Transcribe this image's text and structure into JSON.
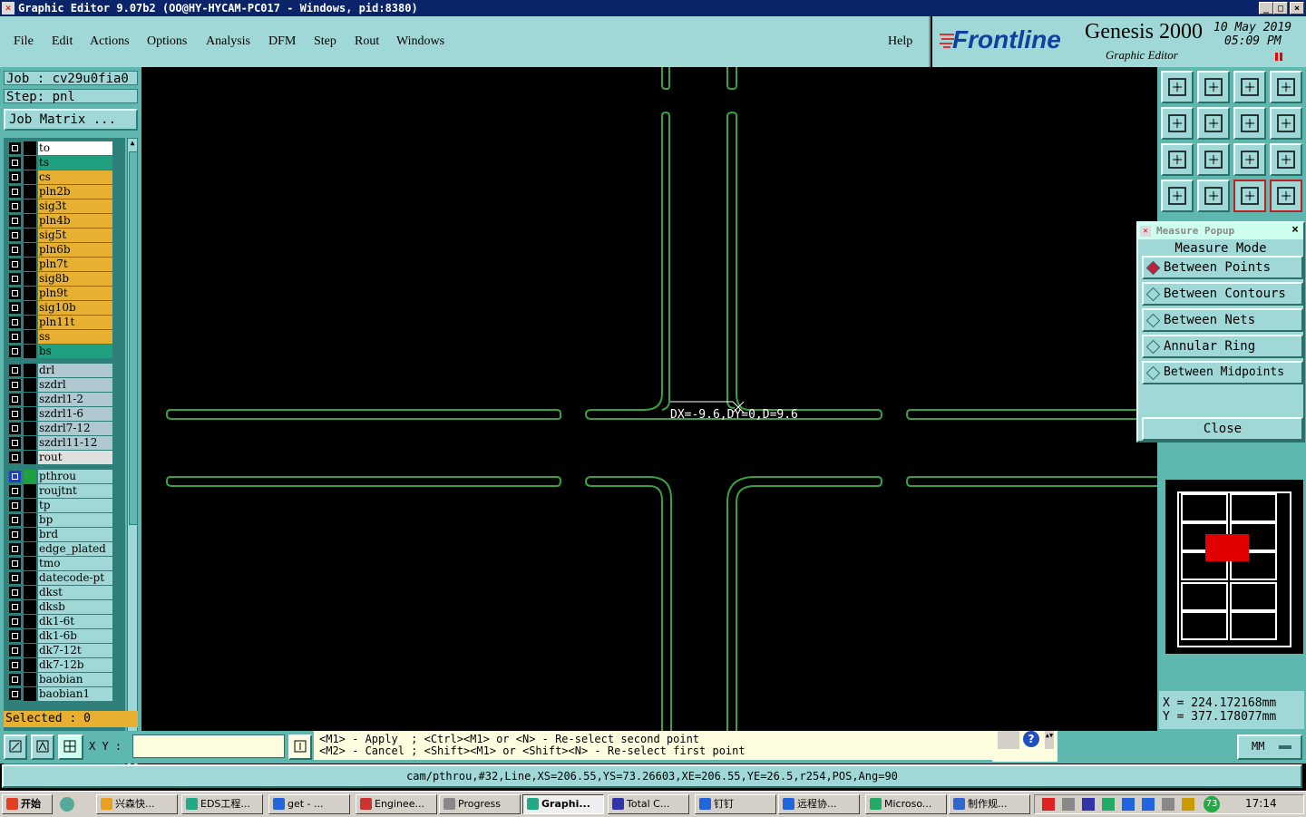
{
  "window": {
    "title": "Graphic Editor 9.07b2 (OO@HY-HYCAM-PC017 - Windows, pid:8380)",
    "controls": [
      "_",
      "□",
      "×"
    ]
  },
  "menu": [
    "File",
    "Edit",
    "Actions",
    "Options",
    "Analysis",
    "DFM",
    "Step",
    "Rout",
    "Windows"
  ],
  "help_label": "Help",
  "brand": {
    "logo": "Frontline",
    "product": "Genesis 2000",
    "subtitle": "Graphic Editor",
    "date": "10 May 2019",
    "time": "05:09 PM"
  },
  "job": {
    "job_line": "Job : cv29u0fia0",
    "step_line": "Step: pnl",
    "matrix_button": "Job Matrix ..."
  },
  "layers": {
    "board": [
      {
        "name": "to",
        "color": "#ffffff"
      },
      {
        "name": "ts",
        "color": "#20a080"
      },
      {
        "name": "cs",
        "color": "#e8b030"
      },
      {
        "name": "pln2b",
        "color": "#e8b030"
      },
      {
        "name": "sig3t",
        "color": "#e8b030"
      },
      {
        "name": "pln4b",
        "color": "#e8b030"
      },
      {
        "name": "sig5t",
        "color": "#e8b030"
      },
      {
        "name": "pln6b",
        "color": "#e8b030"
      },
      {
        "name": "pln7t",
        "color": "#e8b030"
      },
      {
        "name": "sig8b",
        "color": "#e8b030"
      },
      {
        "name": "pln9t",
        "color": "#e8b030"
      },
      {
        "name": "sig10b",
        "color": "#e8b030"
      },
      {
        "name": "pln11t",
        "color": "#e8b030"
      },
      {
        "name": "ss",
        "color": "#e8b030"
      },
      {
        "name": "bs",
        "color": "#20a080"
      }
    ],
    "drill": [
      {
        "name": "drl",
        "color": "#b0c8d0"
      },
      {
        "name": "szdrl",
        "color": "#b0c8d0"
      },
      {
        "name": "szdrl1-2",
        "color": "#b0c8d0"
      },
      {
        "name": "szdrl1-6",
        "color": "#b0c8d0"
      },
      {
        "name": "szdrl7-12",
        "color": "#b0c8d0"
      },
      {
        "name": "szdrl11-12",
        "color": "#b0c8d0"
      },
      {
        "name": "rout",
        "color": "#e0e0e0"
      }
    ],
    "misc": [
      {
        "name": "pthrou",
        "color": "#9fd8d6"
      },
      {
        "name": "roujtnt",
        "color": "#9fd8d6"
      },
      {
        "name": "tp",
        "color": "#9fd8d6"
      },
      {
        "name": "bp",
        "color": "#9fd8d6"
      },
      {
        "name": "brd",
        "color": "#9fd8d6"
      },
      {
        "name": "edge_plated",
        "color": "#9fd8d6"
      },
      {
        "name": "tmo",
        "color": "#9fd8d6"
      },
      {
        "name": "datecode-pt",
        "color": "#9fd8d6"
      },
      {
        "name": "dkst",
        "color": "#9fd8d6"
      },
      {
        "name": "dksb",
        "color": "#9fd8d6"
      },
      {
        "name": "dk1-6t",
        "color": "#9fd8d6"
      },
      {
        "name": "dk1-6b",
        "color": "#9fd8d6"
      },
      {
        "name": "dk7-12t",
        "color": "#9fd8d6"
      },
      {
        "name": "dk7-12b",
        "color": "#9fd8d6"
      },
      {
        "name": "baobian",
        "color": "#9fd8d6"
      },
      {
        "name": "baobian1",
        "color": "#9fd8d6"
      }
    ],
    "selected_text": "Selected : 0"
  },
  "canvas": {
    "measure_label": "DX=-9.6,DY=0,D=9.6",
    "line_color": "#3aa040"
  },
  "measure_popup": {
    "title": "Measure Popup",
    "mode_label": "Measure Mode",
    "options": [
      {
        "label": "Between Points",
        "selected": true
      },
      {
        "label": "Between Contours",
        "selected": false
      },
      {
        "label": "Between Nets",
        "selected": false
      },
      {
        "label": "Annular Ring",
        "selected": false
      },
      {
        "label": "Between Midpoints",
        "selected": false
      }
    ],
    "close_label": "Close"
  },
  "coordinates": {
    "x": "X = 224.172168mm",
    "y": "Y = 377.178077mm"
  },
  "command": {
    "xy_label": "X Y :",
    "xy_value": "",
    "hint1": "<M1> - Apply  ; <Ctrl><M1> or <N> - Re-select second point",
    "hint2": "<M2> - Cancel ; <Shift><M1> or <Shift><N> - Re-select first point",
    "units": "MM"
  },
  "status_line": "cam/pthrou,#32,Line,XS=206.55,YS=73.26603,XE=206.55,YE=26.5,r254,POS,Ang=90",
  "taskbar": {
    "start": "开始",
    "tasks": [
      "兴森快...",
      "EDS工程...",
      "get - ...",
      "Enginee...",
      "Progress",
      "Graphi...",
      "Total C...",
      "钉钉",
      "远程协...",
      "Microso...",
      "制作规..."
    ],
    "active_index": 5,
    "clock": "17:14",
    "badge": "73"
  }
}
